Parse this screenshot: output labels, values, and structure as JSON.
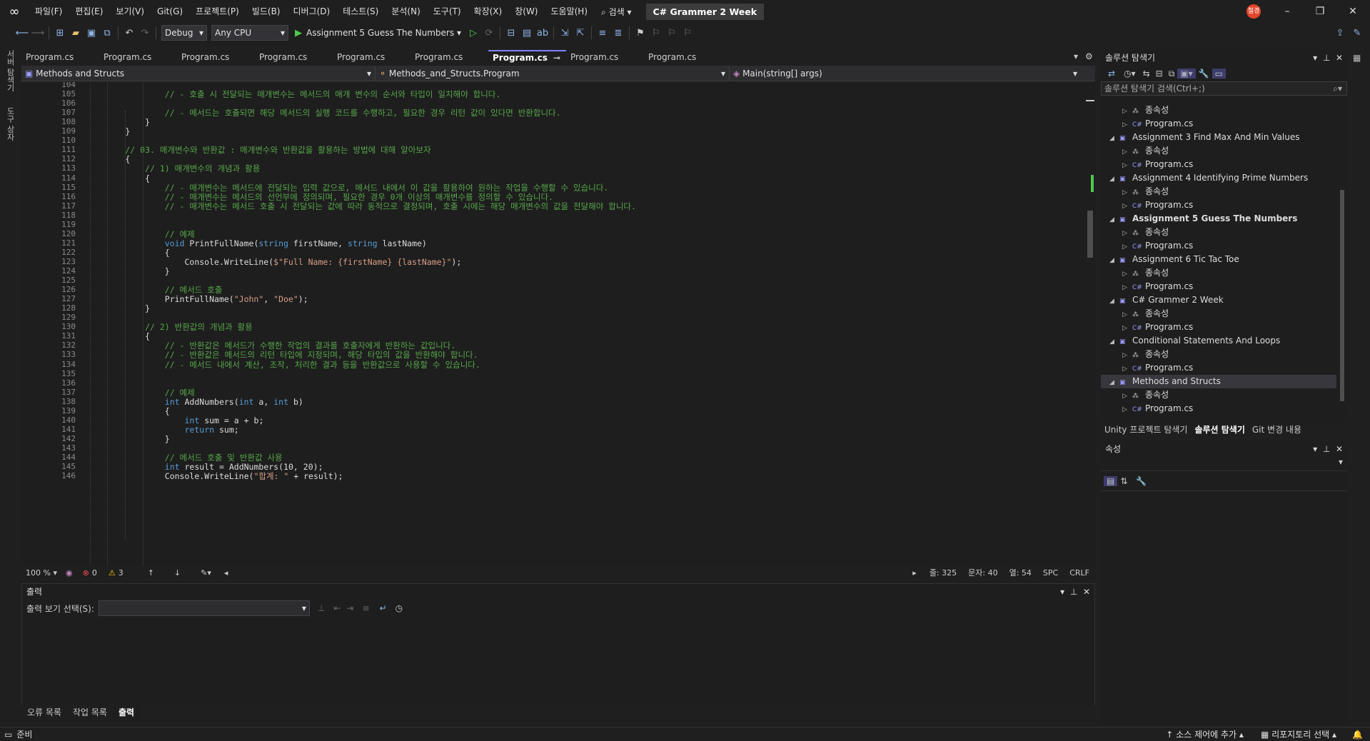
{
  "menu": {
    "items": [
      "파일(F)",
      "편집(E)",
      "보기(V)",
      "Git(G)",
      "프로젝트(P)",
      "빌드(B)",
      "디버그(D)",
      "테스트(S)",
      "분석(N)",
      "도구(T)",
      "확장(X)",
      "창(W)",
      "도움말(H)"
    ],
    "search_label": "검색",
    "solution_name": "C# Grammer 2 Week",
    "avatar_text": "철경"
  },
  "toolbar": {
    "config": "Debug",
    "platform": "Any CPU",
    "startup_project": "Assignment 5 Guess The Numbers"
  },
  "left_strip": {
    "server_explorer": "서버 탐색기",
    "toolbox": "도구 상자"
  },
  "doc_tabs": [
    {
      "label": "Program.cs",
      "active": false
    },
    {
      "label": "Program.cs",
      "active": false
    },
    {
      "label": "Program.cs",
      "active": false
    },
    {
      "label": "Program.cs",
      "active": false
    },
    {
      "label": "Program.cs",
      "active": false
    },
    {
      "label": "Program.cs",
      "active": false
    },
    {
      "label": "Program.cs",
      "active": true
    },
    {
      "label": "Program.cs",
      "active": false
    },
    {
      "label": "Program.cs",
      "active": false
    }
  ],
  "navbar": {
    "project": "Methods and Structs",
    "type": "Methods_and_Structs.Program",
    "member": "Main(string[] args)"
  },
  "code": {
    "lines": [
      {
        "n": "104",
        "t": ""
      },
      {
        "n": "105",
        "t": "                // - 호출 시 전달되는 매개변수는 메서드의 매개 변수의 순서와 타입이 일치해야 합니다.",
        "c": "cm"
      },
      {
        "n": "106",
        "t": ""
      },
      {
        "n": "107",
        "t": "                // - 메서드는 호출되면 해당 메서드의 실행 코드를 수행하고, 필요한 경우 리턴 값이 있다면 반환합니다.",
        "c": "cm"
      },
      {
        "n": "108",
        "t": "            }"
      },
      {
        "n": "109",
        "t": "        }"
      },
      {
        "n": "110",
        "t": ""
      },
      {
        "n": "111",
        "t": "        // 03. 매개변수와 반환값 : 매개변수와 반환값을 활용하는 방법에 대해 알아보자",
        "c": "cm"
      },
      {
        "n": "112",
        "t": "        {"
      },
      {
        "n": "113",
        "t": "            // 1) 매개변수의 개념과 활용",
        "c": "cm"
      },
      {
        "n": "114",
        "t": "            {"
      },
      {
        "n": "115",
        "t": "                // - 매개변수는 메서드에 전달되는 입력 값으로, 메서드 내에서 이 값을 활용하여 원하는 작업을 수행할 수 있습니다.",
        "c": "cm"
      },
      {
        "n": "116",
        "t": "                // - 매개변수는 메서드의 선언부에 정의되며, 필요한 경우 0개 이상의 매개변수를 정의할 수 있습니다.",
        "c": "cm"
      },
      {
        "n": "117",
        "t": "                // - 매개변수는 메서드 호출 시 전달되는 값에 따라 동적으로 결정되며, 호출 시에는 해당 매개변수의 값을 전달해야 합니다.",
        "c": "cm"
      },
      {
        "n": "118",
        "t": ""
      },
      {
        "n": "119",
        "t": ""
      },
      {
        "n": "120",
        "t": "                // 예제",
        "c": "cm"
      },
      {
        "n": "121",
        "t": "                void PrintFullName(string firstName, string lastName)"
      },
      {
        "n": "122",
        "t": "                {"
      },
      {
        "n": "123",
        "t": "                    Console.WriteLine($\"Full Name: {firstName} {lastName}\");"
      },
      {
        "n": "124",
        "t": "                }"
      },
      {
        "n": "125",
        "t": ""
      },
      {
        "n": "126",
        "t": "                // 메서드 호출",
        "c": "cm"
      },
      {
        "n": "127",
        "t": "                PrintFullName(\"John\", \"Doe\");"
      },
      {
        "n": "128",
        "t": "            }"
      },
      {
        "n": "129",
        "t": ""
      },
      {
        "n": "130",
        "t": "            // 2) 반환값의 개념과 활용",
        "c": "cm"
      },
      {
        "n": "131",
        "t": "            {"
      },
      {
        "n": "132",
        "t": "                // - 반환값은 메서드가 수행한 작업의 결과를 호출자에게 반환하는 값입니다.",
        "c": "cm"
      },
      {
        "n": "133",
        "t": "                // - 반환값은 메서드의 리턴 타입에 지정되며, 해당 타입의 값을 반환해야 합니다.",
        "c": "cm"
      },
      {
        "n": "134",
        "t": "                // - 메서드 내에서 계산, 조작, 처리한 결과 등을 반환값으로 사용할 수 있습니다.",
        "c": "cm"
      },
      {
        "n": "135",
        "t": ""
      },
      {
        "n": "136",
        "t": ""
      },
      {
        "n": "137",
        "t": "                // 예제",
        "c": "cm"
      },
      {
        "n": "138",
        "t": "                int AddNumbers(int a, int b)"
      },
      {
        "n": "139",
        "t": "                {"
      },
      {
        "n": "140",
        "t": "                    int sum = a + b;"
      },
      {
        "n": "141",
        "t": "                    return sum;"
      },
      {
        "n": "142",
        "t": "                }"
      },
      {
        "n": "143",
        "t": ""
      },
      {
        "n": "144",
        "t": "                // 메서드 호출 및 반환값 사용",
        "c": "cm"
      },
      {
        "n": "145",
        "t": "                int result = AddNumbers(10, 20);"
      },
      {
        "n": "146",
        "t": "                Console.WriteLine(\"합계: \" + result);"
      }
    ]
  },
  "editor_status": {
    "zoom": "100 %",
    "errors": "0",
    "warnings": "3",
    "line": "줄: 325",
    "char": "문자: 40",
    "col": "열: 54",
    "spc": "SPC",
    "crlf": "CRLF"
  },
  "output": {
    "title": "출력",
    "show_label": "출력 보기 선택(S):"
  },
  "bottom_tabs": [
    "오류 목록",
    "작업 목록",
    "출력"
  ],
  "solution_explorer": {
    "title": "솔루션 탐색기",
    "search_placeholder": "솔루션 탐색기 검색(Ctrl+;)",
    "items": [
      {
        "label": "종속성",
        "depth": 2,
        "kind": "dep",
        "expanded": false
      },
      {
        "label": "Program.cs",
        "depth": 2,
        "kind": "cs",
        "expanded": false
      },
      {
        "label": "Assignment 3 Find Max And Min Values",
        "depth": 1,
        "kind": "proj",
        "expanded": true
      },
      {
        "label": "종속성",
        "depth": 2,
        "kind": "dep",
        "expanded": false
      },
      {
        "label": "Program.cs",
        "depth": 2,
        "kind": "cs",
        "expanded": false
      },
      {
        "label": "Assignment 4 Identifying Prime Numbers",
        "depth": 1,
        "kind": "proj",
        "expanded": true
      },
      {
        "label": "종속성",
        "depth": 2,
        "kind": "dep",
        "expanded": false
      },
      {
        "label": "Program.cs",
        "depth": 2,
        "kind": "cs",
        "expanded": false
      },
      {
        "label": "Assignment 5 Guess The Numbers",
        "depth": 1,
        "kind": "proj",
        "expanded": true,
        "bold": true
      },
      {
        "label": "종속성",
        "depth": 2,
        "kind": "dep",
        "expanded": false
      },
      {
        "label": "Program.cs",
        "depth": 2,
        "kind": "cs",
        "expanded": false
      },
      {
        "label": "Assignment 6 Tic Tac Toe",
        "depth": 1,
        "kind": "proj",
        "expanded": true
      },
      {
        "label": "종속성",
        "depth": 2,
        "kind": "dep",
        "expanded": false
      },
      {
        "label": "Program.cs",
        "depth": 2,
        "kind": "cs",
        "expanded": false
      },
      {
        "label": "C# Grammer 2 Week",
        "depth": 1,
        "kind": "proj",
        "expanded": true
      },
      {
        "label": "종속성",
        "depth": 2,
        "kind": "dep",
        "expanded": false
      },
      {
        "label": "Program.cs",
        "depth": 2,
        "kind": "cs",
        "expanded": false
      },
      {
        "label": "Conditional Statements And Loops",
        "depth": 1,
        "kind": "proj",
        "expanded": true
      },
      {
        "label": "종속성",
        "depth": 2,
        "kind": "dep",
        "expanded": false
      },
      {
        "label": "Program.cs",
        "depth": 2,
        "kind": "cs",
        "expanded": false
      },
      {
        "label": "Methods and Structs",
        "depth": 1,
        "kind": "proj",
        "expanded": true,
        "selected": true
      },
      {
        "label": "종속성",
        "depth": 2,
        "kind": "dep",
        "expanded": false
      },
      {
        "label": "Program.cs",
        "depth": 2,
        "kind": "cs",
        "expanded": false
      }
    ]
  },
  "se_tabs": [
    "Unity 프로젝트 탐색기",
    "솔루션 탐색기",
    "Git 변경 내용"
  ],
  "properties": {
    "title": "속성"
  },
  "status": {
    "ready": "준비",
    "source_control": "소스 제어에 추가",
    "repo": "리포지토리 선택"
  },
  "colors": {
    "accent": "#7f7fff",
    "comment": "#57a64a",
    "keyword": "#569cd6",
    "string": "#d69d85"
  }
}
